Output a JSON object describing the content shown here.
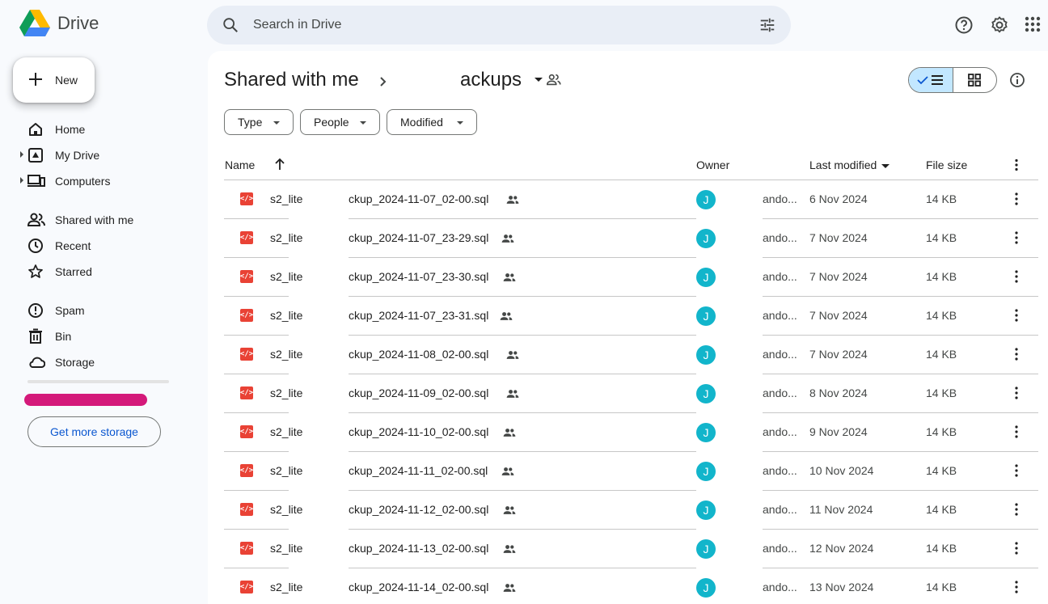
{
  "app": {
    "name": "Drive"
  },
  "search": {
    "placeholder": "Search in Drive"
  },
  "sidebar": {
    "new_label": "New",
    "items": [
      {
        "label": "Home",
        "icon": "home-icon",
        "caret": false
      },
      {
        "label": "My Drive",
        "icon": "my-drive-icon",
        "caret": true
      },
      {
        "label": "Computers",
        "icon": "computers-icon",
        "caret": true
      },
      {
        "label": "Shared with me",
        "icon": "shared-with-me-icon",
        "caret": false
      },
      {
        "label": "Recent",
        "icon": "recent-icon",
        "caret": false
      },
      {
        "label": "Starred",
        "icon": "star-icon",
        "caret": false
      },
      {
        "label": "Spam",
        "icon": "spam-icon",
        "caret": false
      },
      {
        "label": "Bin",
        "icon": "bin-icon",
        "caret": false
      },
      {
        "label": "Storage",
        "icon": "cloud-icon",
        "caret": false
      }
    ],
    "get_storage_label": "Get more storage"
  },
  "breadcrumb": {
    "root": "Shared with me",
    "current": "ackups"
  },
  "filters": {
    "type": "Type",
    "people": "People",
    "modified": "Modified"
  },
  "table": {
    "headers": {
      "name": "Name",
      "owner": "Owner",
      "last_modified": "Last modified",
      "file_size": "File size"
    },
    "rows": [
      {
        "name_prefix": "s2_lite",
        "name_suffix": "ckup_2024-11-07_02-00.sql",
        "owner_initial": "J",
        "owner": "ando...",
        "modified": "6 Nov 2024",
        "size": "14 KB"
      },
      {
        "name_prefix": "s2_lite",
        "name_suffix": "ckup_2024-11-07_23-29.sql",
        "owner_initial": "J",
        "owner": "ando...",
        "modified": "7 Nov 2024",
        "size": "14 KB"
      },
      {
        "name_prefix": "s2_lite",
        "name_suffix": "ckup_2024-11-07_23-30.sql",
        "owner_initial": "J",
        "owner": "ando...",
        "modified": "7 Nov 2024",
        "size": "14 KB"
      },
      {
        "name_prefix": "s2_lite",
        "name_suffix": "ckup_2024-11-07_23-31.sql",
        "owner_initial": "J",
        "owner": "ando...",
        "modified": "7 Nov 2024",
        "size": "14 KB"
      },
      {
        "name_prefix": "s2_lite",
        "name_suffix": "ckup_2024-11-08_02-00.sql",
        "owner_initial": "J",
        "owner": "ando...",
        "modified": "7 Nov 2024",
        "size": "14 KB"
      },
      {
        "name_prefix": "s2_lite",
        "name_suffix": "ckup_2024-11-09_02-00.sql",
        "owner_initial": "J",
        "owner": "ando...",
        "modified": "8 Nov 2024",
        "size": "14 KB"
      },
      {
        "name_prefix": "s2_lite",
        "name_suffix": "ckup_2024-11-10_02-00.sql",
        "owner_initial": "J",
        "owner": "ando...",
        "modified": "9 Nov 2024",
        "size": "14 KB"
      },
      {
        "name_prefix": "s2_lite",
        "name_suffix": "ckup_2024-11-11_02-00.sql",
        "owner_initial": "J",
        "owner": "ando...",
        "modified": "10 Nov 2024",
        "size": "14 KB"
      },
      {
        "name_prefix": "s2_lite",
        "name_suffix": "ckup_2024-11-12_02-00.sql",
        "owner_initial": "J",
        "owner": "ando...",
        "modified": "11 Nov 2024",
        "size": "14 KB"
      },
      {
        "name_prefix": "s2_lite",
        "name_suffix": "ckup_2024-11-13_02-00.sql",
        "owner_initial": "J",
        "owner": "ando...",
        "modified": "12 Nov 2024",
        "size": "14 KB"
      },
      {
        "name_prefix": "s2_lite",
        "name_suffix": "ckup_2024-11-14_02-00.sql",
        "owner_initial": "J",
        "owner": "ando...",
        "modified": "13 Nov 2024",
        "size": "14 KB"
      }
    ]
  },
  "colors": {
    "accent": "#0b57d0",
    "selected_toggle": "#c2e7ff",
    "avatar": "#12b5cb",
    "file_icon": "#e94235"
  }
}
